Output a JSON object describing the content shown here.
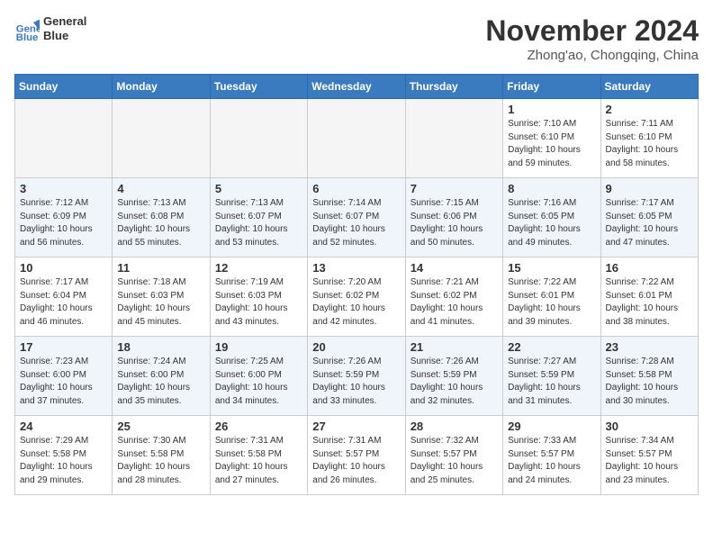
{
  "header": {
    "logo_line1": "General",
    "logo_line2": "Blue",
    "month": "November 2024",
    "location": "Zhong'ao, Chongqing, China"
  },
  "weekdays": [
    "Sunday",
    "Monday",
    "Tuesday",
    "Wednesday",
    "Thursday",
    "Friday",
    "Saturday"
  ],
  "weeks": [
    [
      {
        "day": "",
        "info": ""
      },
      {
        "day": "",
        "info": ""
      },
      {
        "day": "",
        "info": ""
      },
      {
        "day": "",
        "info": ""
      },
      {
        "day": "",
        "info": ""
      },
      {
        "day": "1",
        "info": "Sunrise: 7:10 AM\nSunset: 6:10 PM\nDaylight: 10 hours and 59 minutes."
      },
      {
        "day": "2",
        "info": "Sunrise: 7:11 AM\nSunset: 6:10 PM\nDaylight: 10 hours and 58 minutes."
      }
    ],
    [
      {
        "day": "3",
        "info": "Sunrise: 7:12 AM\nSunset: 6:09 PM\nDaylight: 10 hours and 56 minutes."
      },
      {
        "day": "4",
        "info": "Sunrise: 7:13 AM\nSunset: 6:08 PM\nDaylight: 10 hours and 55 minutes."
      },
      {
        "day": "5",
        "info": "Sunrise: 7:13 AM\nSunset: 6:07 PM\nDaylight: 10 hours and 53 minutes."
      },
      {
        "day": "6",
        "info": "Sunrise: 7:14 AM\nSunset: 6:07 PM\nDaylight: 10 hours and 52 minutes."
      },
      {
        "day": "7",
        "info": "Sunrise: 7:15 AM\nSunset: 6:06 PM\nDaylight: 10 hours and 50 minutes."
      },
      {
        "day": "8",
        "info": "Sunrise: 7:16 AM\nSunset: 6:05 PM\nDaylight: 10 hours and 49 minutes."
      },
      {
        "day": "9",
        "info": "Sunrise: 7:17 AM\nSunset: 6:05 PM\nDaylight: 10 hours and 47 minutes."
      }
    ],
    [
      {
        "day": "10",
        "info": "Sunrise: 7:17 AM\nSunset: 6:04 PM\nDaylight: 10 hours and 46 minutes."
      },
      {
        "day": "11",
        "info": "Sunrise: 7:18 AM\nSunset: 6:03 PM\nDaylight: 10 hours and 45 minutes."
      },
      {
        "day": "12",
        "info": "Sunrise: 7:19 AM\nSunset: 6:03 PM\nDaylight: 10 hours and 43 minutes."
      },
      {
        "day": "13",
        "info": "Sunrise: 7:20 AM\nSunset: 6:02 PM\nDaylight: 10 hours and 42 minutes."
      },
      {
        "day": "14",
        "info": "Sunrise: 7:21 AM\nSunset: 6:02 PM\nDaylight: 10 hours and 41 minutes."
      },
      {
        "day": "15",
        "info": "Sunrise: 7:22 AM\nSunset: 6:01 PM\nDaylight: 10 hours and 39 minutes."
      },
      {
        "day": "16",
        "info": "Sunrise: 7:22 AM\nSunset: 6:01 PM\nDaylight: 10 hours and 38 minutes."
      }
    ],
    [
      {
        "day": "17",
        "info": "Sunrise: 7:23 AM\nSunset: 6:00 PM\nDaylight: 10 hours and 37 minutes."
      },
      {
        "day": "18",
        "info": "Sunrise: 7:24 AM\nSunset: 6:00 PM\nDaylight: 10 hours and 35 minutes."
      },
      {
        "day": "19",
        "info": "Sunrise: 7:25 AM\nSunset: 6:00 PM\nDaylight: 10 hours and 34 minutes."
      },
      {
        "day": "20",
        "info": "Sunrise: 7:26 AM\nSunset: 5:59 PM\nDaylight: 10 hours and 33 minutes."
      },
      {
        "day": "21",
        "info": "Sunrise: 7:26 AM\nSunset: 5:59 PM\nDaylight: 10 hours and 32 minutes."
      },
      {
        "day": "22",
        "info": "Sunrise: 7:27 AM\nSunset: 5:59 PM\nDaylight: 10 hours and 31 minutes."
      },
      {
        "day": "23",
        "info": "Sunrise: 7:28 AM\nSunset: 5:58 PM\nDaylight: 10 hours and 30 minutes."
      }
    ],
    [
      {
        "day": "24",
        "info": "Sunrise: 7:29 AM\nSunset: 5:58 PM\nDaylight: 10 hours and 29 minutes."
      },
      {
        "day": "25",
        "info": "Sunrise: 7:30 AM\nSunset: 5:58 PM\nDaylight: 10 hours and 28 minutes."
      },
      {
        "day": "26",
        "info": "Sunrise: 7:31 AM\nSunset: 5:58 PM\nDaylight: 10 hours and 27 minutes."
      },
      {
        "day": "27",
        "info": "Sunrise: 7:31 AM\nSunset: 5:57 PM\nDaylight: 10 hours and 26 minutes."
      },
      {
        "day": "28",
        "info": "Sunrise: 7:32 AM\nSunset: 5:57 PM\nDaylight: 10 hours and 25 minutes."
      },
      {
        "day": "29",
        "info": "Sunrise: 7:33 AM\nSunset: 5:57 PM\nDaylight: 10 hours and 24 minutes."
      },
      {
        "day": "30",
        "info": "Sunrise: 7:34 AM\nSunset: 5:57 PM\nDaylight: 10 hours and 23 minutes."
      }
    ]
  ]
}
